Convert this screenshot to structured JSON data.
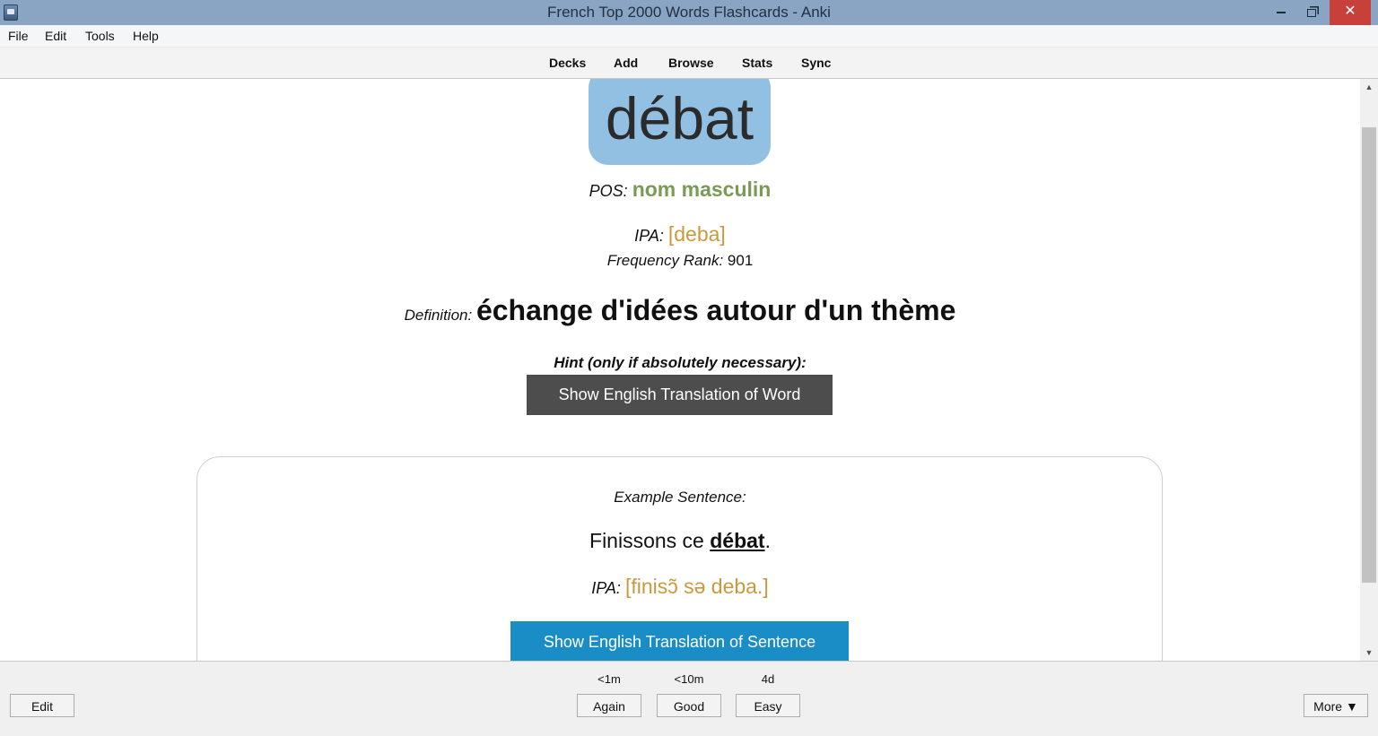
{
  "window": {
    "title": "French Top 2000 Words Flashcards - Anki",
    "close_glyph": "✕"
  },
  "menu": [
    "File",
    "Edit",
    "Tools",
    "Help"
  ],
  "toolbar": [
    "Decks",
    "Add",
    "Browse",
    "Stats",
    "Sync"
  ],
  "card": {
    "word": "débat",
    "pos_label": "POS:",
    "pos_value": "nom masculin",
    "ipa_label": "IPA:",
    "ipa_value": "[deba]",
    "freq_label": "Frequency Rank:",
    "freq_value": "901",
    "definition_label": "Definition:",
    "definition_value": "échange d'idées autour d'un thème",
    "hint_label": "Hint (only if absolutely necessary):",
    "show_word_translation": "Show English Translation of Word",
    "example_label": "Example Sentence:",
    "example_before": "Finissons ce ",
    "example_word": "débat",
    "example_after": ".",
    "example_ipa_label": "IPA:",
    "example_ipa_value": "[finisɔ̃ sə deba.]",
    "show_sentence_translation": "Show English Translation of Sentence"
  },
  "scrollbar": {
    "up": "▲",
    "down": "▼"
  },
  "bottom": {
    "edit": "Edit",
    "intervals": [
      "<1m",
      "<10m",
      "4d"
    ],
    "answers": [
      "Again",
      "Good",
      "Easy"
    ],
    "more": "More ▼"
  },
  "colors": {
    "titlebar": "#8aa5c3",
    "word_box": "#92c0e3",
    "pos": "#7a9a55",
    "ipa": "#c89a3e",
    "word_button": "#4d4d4d",
    "sentence_button": "#1a8dc7",
    "close_button": "#c7413a"
  }
}
